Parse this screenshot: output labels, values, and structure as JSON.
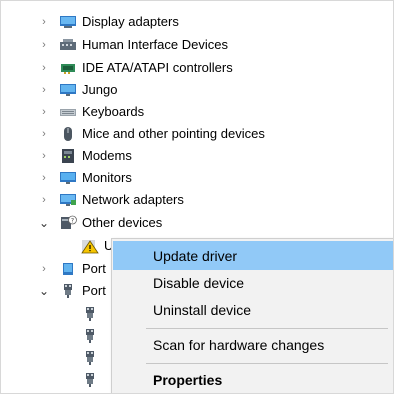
{
  "tree": {
    "items": [
      {
        "label": "Display adapters",
        "icon": "display-adapter-icon",
        "expanded": false
      },
      {
        "label": "Human Interface Devices",
        "icon": "hid-icon",
        "expanded": false
      },
      {
        "label": "IDE ATA/ATAPI controllers",
        "icon": "ide-controller-icon",
        "expanded": false
      },
      {
        "label": "Jungo",
        "icon": "monitor-icon",
        "expanded": false
      },
      {
        "label": "Keyboards",
        "icon": "keyboard-icon",
        "expanded": false
      },
      {
        "label": "Mice and other pointing devices",
        "icon": "mouse-icon",
        "expanded": false
      },
      {
        "label": "Modems",
        "icon": "modem-icon",
        "expanded": false
      },
      {
        "label": "Monitors",
        "icon": "monitor-icon",
        "expanded": false
      },
      {
        "label": "Network adapters",
        "icon": "network-adapter-icon",
        "expanded": false
      },
      {
        "label": "Other devices",
        "icon": "other-devices-icon",
        "expanded": true
      },
      {
        "label": "U",
        "icon": "unknown-device-warning-icon",
        "expanded": null
      },
      {
        "label": "Port",
        "icon": "port-icon",
        "expanded": false
      },
      {
        "label": "Port",
        "icon": "usb-plug-icon",
        "expanded": true
      }
    ],
    "child_ports_icon": "usb-plug-icon"
  },
  "context_menu": {
    "items": [
      {
        "label": "Update driver",
        "highlighted": true
      },
      {
        "label": "Disable device",
        "highlighted": false
      },
      {
        "label": "Uninstall device",
        "highlighted": false
      },
      {
        "label": "Scan for hardware changes",
        "highlighted": false
      },
      {
        "label": "Properties",
        "highlighted": false,
        "bold": true
      }
    ]
  },
  "colors": {
    "menu_background": "#f2f2f2",
    "menu_highlight": "#91c9f7",
    "chevron": "#7a7a7a"
  }
}
